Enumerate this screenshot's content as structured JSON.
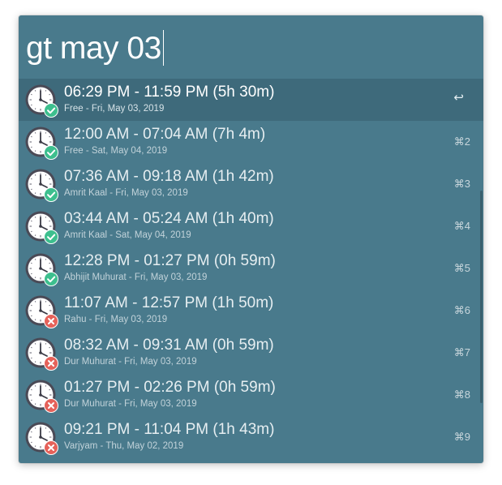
{
  "search": {
    "query": "gt may 03"
  },
  "results": [
    {
      "title": "06:29 PM - 11:59 PM (5h 30m)",
      "subtitle": "Free - Fri, May 03, 2019",
      "shortcut": "↩",
      "status": "good",
      "selected": true
    },
    {
      "title": "12:00 AM - 07:04 AM (7h 4m)",
      "subtitle": "Free - Sat, May 04, 2019",
      "shortcut": "⌘2",
      "status": "good",
      "selected": false
    },
    {
      "title": "07:36 AM - 09:18 AM (1h 42m)",
      "subtitle": "Amrit Kaal - Fri, May 03, 2019",
      "shortcut": "⌘3",
      "status": "good",
      "selected": false
    },
    {
      "title": "03:44 AM - 05:24 AM (1h 40m)",
      "subtitle": "Amrit Kaal - Sat, May 04, 2019",
      "shortcut": "⌘4",
      "status": "good",
      "selected": false
    },
    {
      "title": "12:28 PM - 01:27 PM (0h 59m)",
      "subtitle": "Abhijit Muhurat - Fri, May 03, 2019",
      "shortcut": "⌘5",
      "status": "good",
      "selected": false
    },
    {
      "title": "11:07 AM - 12:57 PM (1h 50m)",
      "subtitle": "Rahu - Fri, May 03, 2019",
      "shortcut": "⌘6",
      "status": "bad",
      "selected": false
    },
    {
      "title": "08:32 AM - 09:31 AM (0h 59m)",
      "subtitle": "Dur Muhurat - Fri, May 03, 2019",
      "shortcut": "⌘7",
      "status": "bad",
      "selected": false
    },
    {
      "title": "01:27 PM - 02:26 PM (0h 59m)",
      "subtitle": "Dur Muhurat - Fri, May 03, 2019",
      "shortcut": "⌘8",
      "status": "bad",
      "selected": false
    },
    {
      "title": "09:21 PM - 11:04 PM (1h 43m)",
      "subtitle": "Varjyam - Thu, May 02, 2019",
      "shortcut": "⌘9",
      "status": "bad",
      "selected": false
    }
  ],
  "icons": {
    "good": "clock-check-icon",
    "bad": "clock-cross-icon"
  },
  "colors": {
    "background": "#497a8c",
    "selected_row": "#3e6a7b",
    "good_badge": "#3dbf8e",
    "bad_badge": "#e5625a",
    "clock_rim": "#4a4a56",
    "clock_face": "#ffffff"
  }
}
